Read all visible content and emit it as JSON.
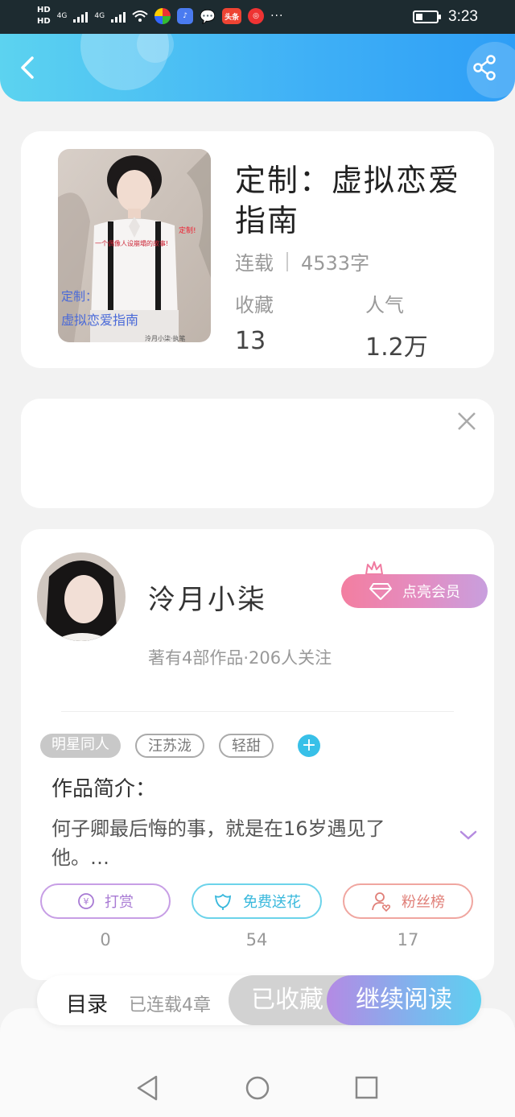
{
  "status_bar": {
    "hd1": "HD",
    "hd2": "HD",
    "signal1": "4G",
    "signal2": "4G",
    "app_toutiao": "头条",
    "more": "···",
    "time": "3:23",
    "icons": [
      "wifi-icon",
      "app-browser-icon",
      "app-music-icon",
      "wechat-icon",
      "app-toutiao-icon",
      "app-weibo-icon",
      "battery-icon"
    ]
  },
  "header": {
    "back_icon": "chevron-left-icon",
    "share_icon": "share-icon",
    "gradient": [
      "#5cd3f0",
      "#2e9ef6"
    ]
  },
  "book": {
    "title": "定制：虚拟恋爱指南",
    "status": "连载",
    "word_count": "4533字",
    "cover_text_top": "定制!",
    "cover_text_line": "一个偶像人设崩塌的故事!",
    "cover_title_a": "定制：",
    "cover_title_b": "虚拟恋爱指南",
    "cover_author": "泠月小柒·执笔",
    "stats": {
      "favorites_label": "收藏",
      "favorites_value": "13",
      "popularity_label": "人气",
      "popularity_value": "1.2万"
    }
  },
  "ad": {
    "close_icon": "close-icon"
  },
  "author": {
    "name": "泠月小柒",
    "works": "著有4部作品·206人关注",
    "vip_label": "点亮会员",
    "vip_icon": "diamond-icon"
  },
  "tags": [
    "明星同人",
    "汪苏泷",
    "轻甜"
  ],
  "intro": {
    "title": "作品简介：",
    "text": "何子卿最后悔的事，就是在16岁遇见了他。…"
  },
  "actions": {
    "reward_label": "打赏",
    "reward_count": "0",
    "flower_label": "免费送花",
    "flower_count": "54",
    "fans_label": "粉丝榜",
    "fans_count": "17"
  },
  "bottom": {
    "toc_label": "目录",
    "toc_count": "已连载4章",
    "fav_label": "已收藏",
    "read_label": "继续阅读"
  },
  "nav": {
    "back": "nav-back-icon",
    "home": "nav-home-icon",
    "recents": "nav-recents-icon"
  }
}
